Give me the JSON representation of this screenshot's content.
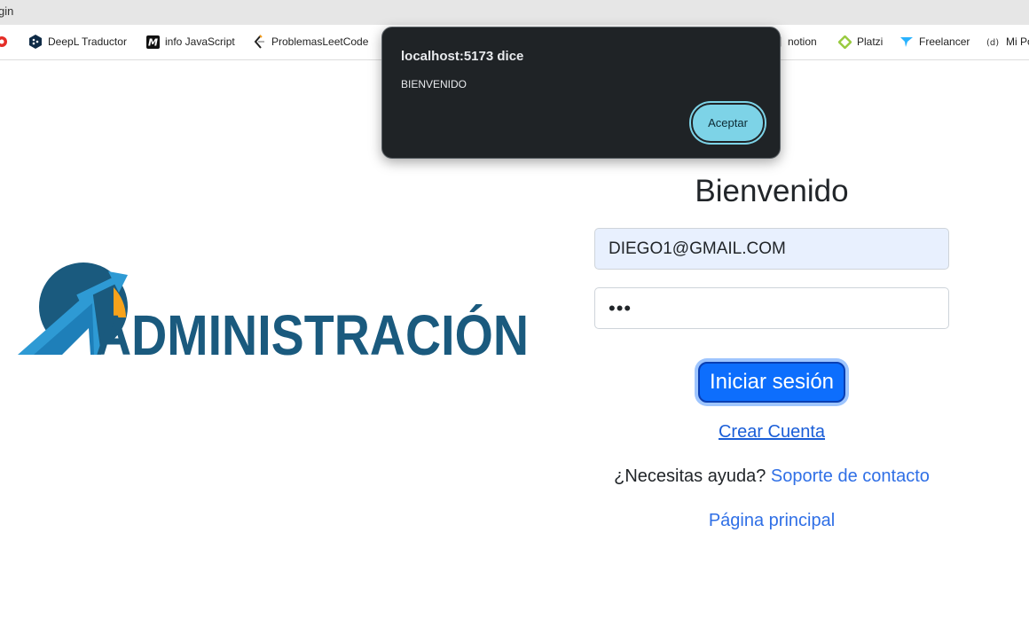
{
  "browser": {
    "title_fragment": "gin"
  },
  "bookmarks": [
    {
      "label": "DeepL Traductor",
      "icon": "deepl-icon"
    },
    {
      "label": "info JavaScript",
      "icon": "m-logo-icon"
    },
    {
      "label": "ProblemasLeetCode",
      "icon": "leetcode-icon"
    },
    {
      "label": "notion",
      "icon": "notion-icon"
    },
    {
      "label": "Platzi",
      "icon": "platzi-icon"
    },
    {
      "label": "Freelancer",
      "icon": "freelancer-icon"
    },
    {
      "label": "Mi Po",
      "icon": "mi-portfolio-icon"
    }
  ],
  "logo": {
    "text": "ADMINISTRACIÓN",
    "colors": {
      "dark": "#1a5a7e",
      "light": "#2e9ad4",
      "accent": "#f7a21b"
    }
  },
  "login": {
    "heading": "Bienvenido",
    "email_value": "DIEGO1@GMAIL.COM",
    "password_mask": "•••",
    "submit_label": "Iniciar sesión",
    "create_account_label": "Crear Cuenta",
    "help_text": "¿Necesitas ayuda?",
    "support_label": "Soporte de contacto",
    "home_label": "Página principal"
  },
  "alert": {
    "title": "localhost:5173 dice",
    "message": "BIENVENIDO",
    "button_label": "Aceptar"
  },
  "colors": {
    "primary": "#0d6efd",
    "link": "#2f6fe6",
    "dialog_bg": "#1f2326",
    "dialog_button": "#7dd3e7"
  }
}
